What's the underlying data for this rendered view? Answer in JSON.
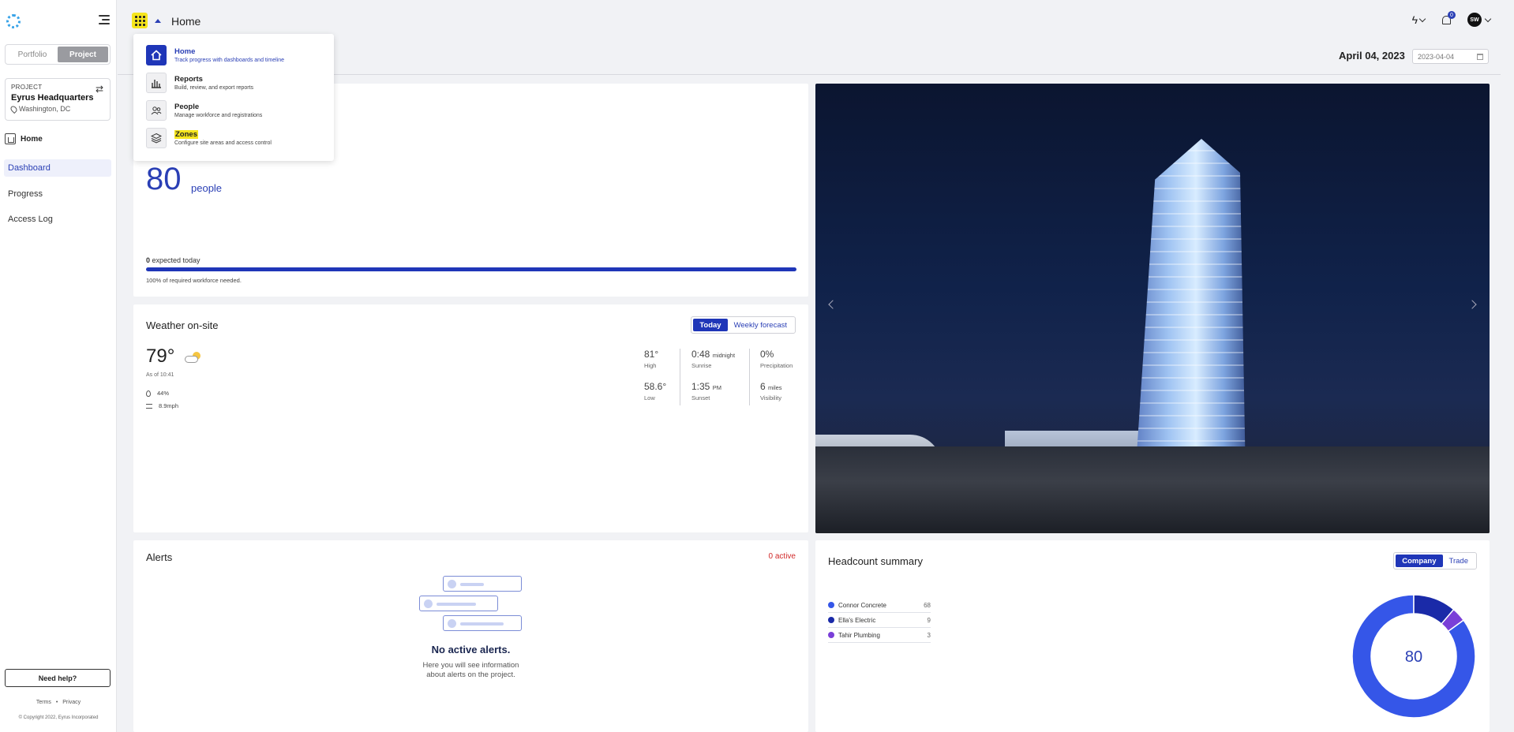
{
  "sidebar": {
    "toggle": {
      "portfolio": "Portfolio",
      "project": "Project"
    },
    "project": {
      "label": "PROJECT",
      "name": "Eyrus Headquarters",
      "location": "Washington, DC"
    },
    "home_label": "Home",
    "nav": [
      {
        "label": "Dashboard",
        "active": true
      },
      {
        "label": "Progress",
        "active": false
      },
      {
        "label": "Access Log",
        "active": false
      }
    ],
    "help_button": "Need help?",
    "terms": "Terms",
    "sep": "•",
    "privacy": "Privacy",
    "copyright": "© Copyright 2022, Eyrus Incorporated"
  },
  "header": {
    "title": "Home",
    "notifications_count": "0",
    "avatar_initials": "SW",
    "date_label": "April 04, 2023",
    "date_value": "2023-04-04"
  },
  "app_menu": [
    {
      "title": "Home",
      "subtitle": "Track progress with dashboards and timeline",
      "icon": "home-icon",
      "active": true
    },
    {
      "title": "Reports",
      "subtitle": "Build, review, and export reports",
      "icon": "bar-chart-icon",
      "active": false
    },
    {
      "title": "People",
      "subtitle": "Manage workforce and registrations",
      "icon": "people-icon",
      "active": false
    },
    {
      "title": "Zones",
      "subtitle": "Configure site areas and access control",
      "icon": "layers-icon",
      "active": false
    }
  ],
  "workforce": {
    "count": "80",
    "unit": "people",
    "expected_num": "0",
    "expected_text": " expected today",
    "progress_pct": 100,
    "caption": "100% of required workforce needed."
  },
  "weather": {
    "title": "Weather on-site",
    "tabs": [
      "Today",
      "Weekly forecast"
    ],
    "temp": "79°",
    "as_of": "As of 10:41",
    "humidity": "44%",
    "wind": "8.9mph",
    "stats": [
      {
        "value": "81°",
        "unit": "",
        "label": "High"
      },
      {
        "value": "58.6°",
        "unit": "",
        "label": "Low"
      },
      {
        "value": "0:48",
        "unit": "midnight",
        "label": "Sunrise"
      },
      {
        "value": "1:35",
        "unit": "PM",
        "label": "Sunset"
      },
      {
        "value": "0%",
        "unit": "",
        "label": "Precipitation"
      },
      {
        "value": "6",
        "unit": "miles",
        "label": "Visibility"
      }
    ]
  },
  "alerts": {
    "title": "Alerts",
    "active": "0 active",
    "empty_title": "No active alerts.",
    "empty_line1": "Here you will see information",
    "empty_line2": "about alerts on the project."
  },
  "headcount": {
    "title": "Headcount summary",
    "tabs": [
      "Company",
      "Trade"
    ],
    "total": "80",
    "rows": [
      {
        "name": "Connor Concrete",
        "count": "68",
        "color": "#3556e8"
      },
      {
        "name": "Ella's Electric",
        "count": "9",
        "color": "#1a2aa8"
      },
      {
        "name": "Tahir Plumbing",
        "count": "3",
        "color": "#7a3fd8"
      }
    ]
  }
}
